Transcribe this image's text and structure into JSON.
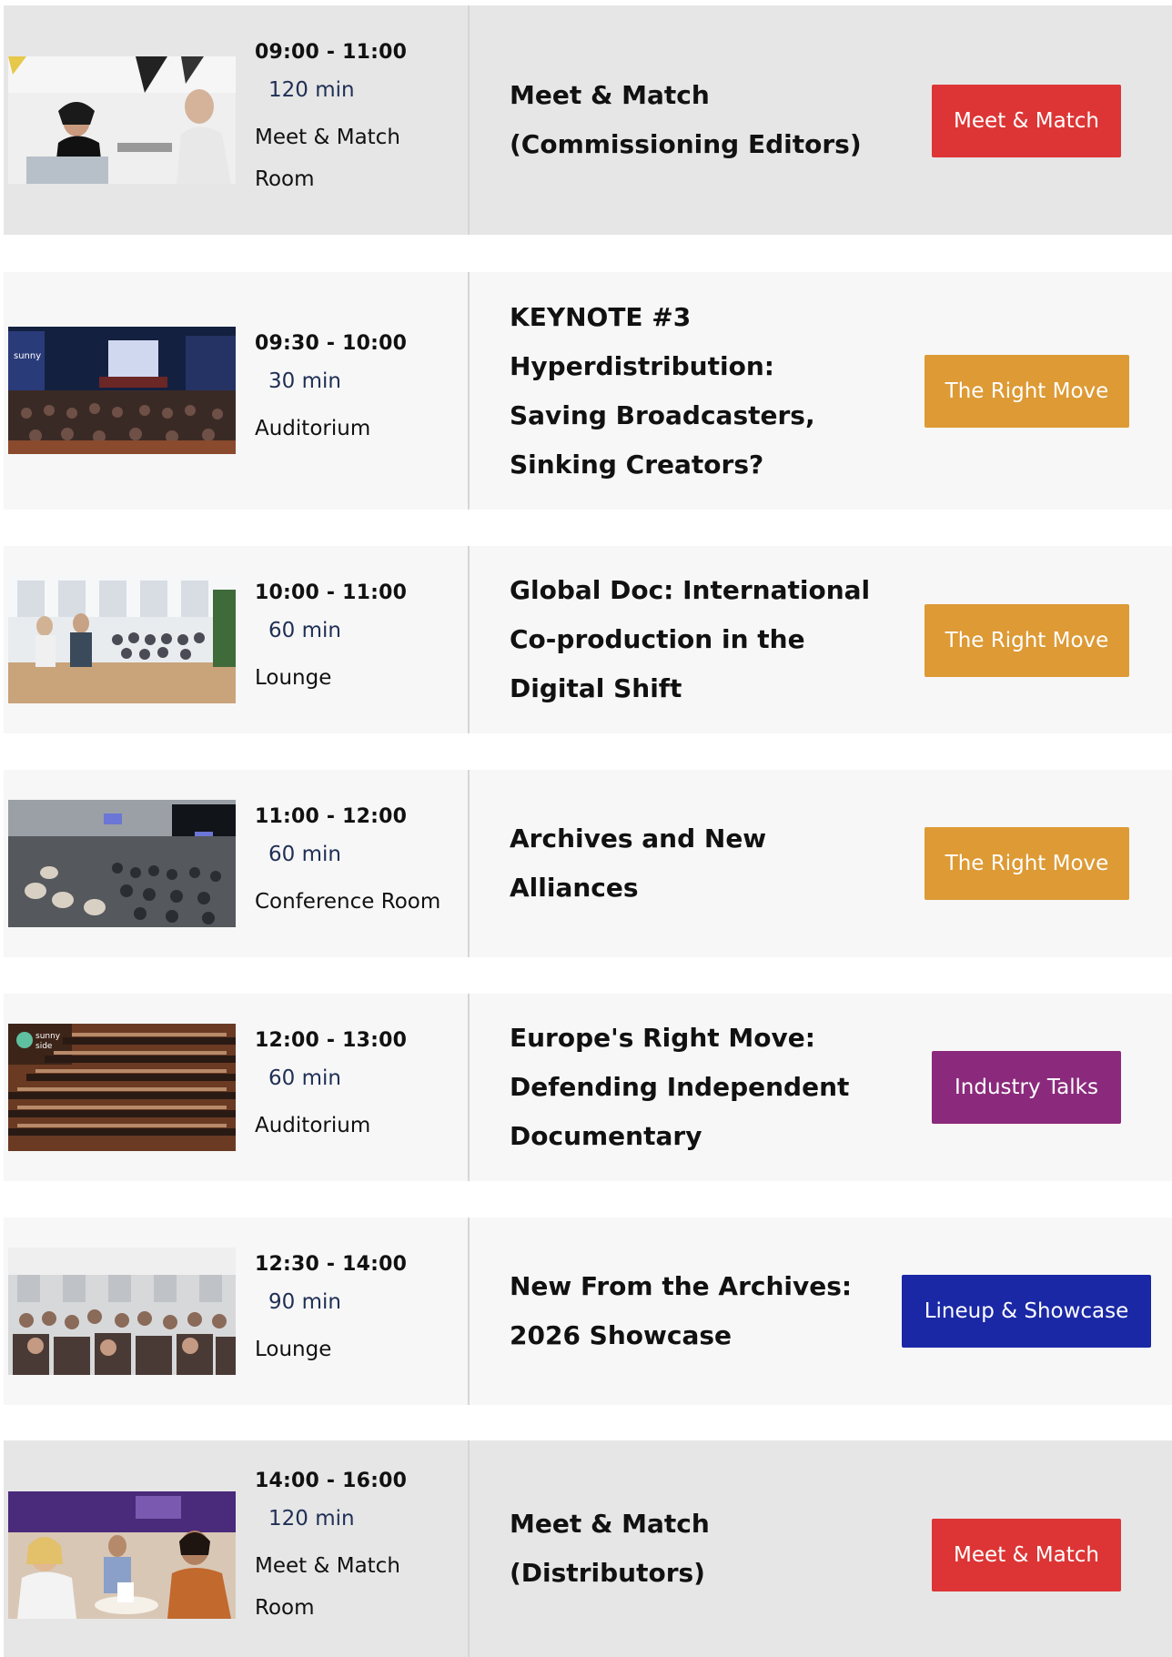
{
  "colors": {
    "meet_match": "#dd3535",
    "right_move": "#dd9a35",
    "industry_talks": "#8b2a7c",
    "lineup_showcase": "#1a28a6"
  },
  "sessions": [
    {
      "time": "09:00 - 11:00",
      "duration": "120 min",
      "room": "Meet & Match Room",
      "title": "Meet & Match (Commissioning Editors)",
      "tag": "Meet & Match"
    },
    {
      "time": "09:30 - 10:00",
      "duration": "30 min",
      "room": "Auditorium",
      "title": "KEYNOTE #3 Hyperdistribution: Saving Broadcasters, Sinking Creators?",
      "tag": "The Right Move"
    },
    {
      "time": "10:00 - 11:00",
      "duration": "60 min",
      "room": "Lounge",
      "title": "Global Doc: International Co-production in the Digital Shift",
      "tag": "The Right Move"
    },
    {
      "time": "11:00 - 12:00",
      "duration": "60 min",
      "room": "Conference Room",
      "title": "Archives and New Alliances",
      "tag": "The Right Move"
    },
    {
      "time": "12:00 - 13:00",
      "duration": "60 min",
      "room": "Auditorium",
      "title": "Europe's Right Move: Defending Independent Documentary",
      "tag": "Industry Talks"
    },
    {
      "time": "12:30 - 14:00",
      "duration": "90 min",
      "room": "Lounge",
      "title": "New From the Archives: 2026 Showcase",
      "tag": "Lineup & Showcase"
    },
    {
      "time": "14:00 - 16:00",
      "duration": "120 min",
      "room": "Meet & Match Room",
      "title": "Meet & Match (Distributors)",
      "tag": "Meet & Match"
    }
  ]
}
